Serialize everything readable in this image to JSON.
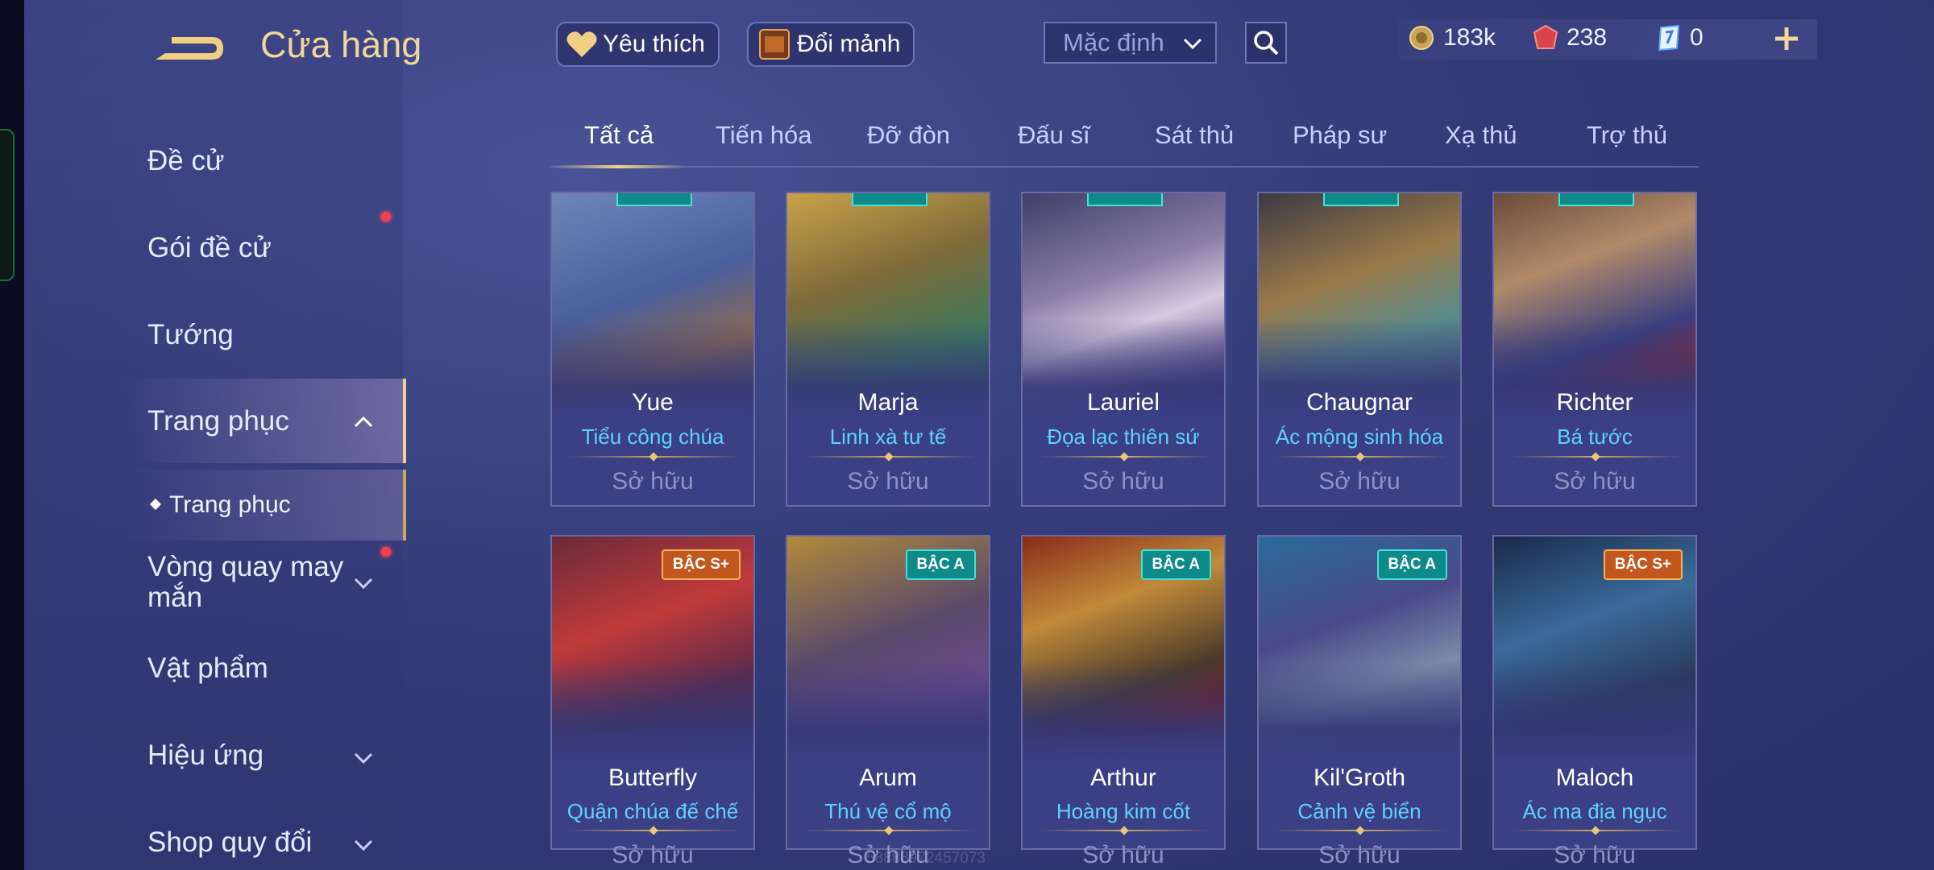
{
  "header": {
    "title": "Cửa hàng"
  },
  "sidebar": {
    "items": [
      {
        "label": "Đề cử"
      },
      {
        "label": "Gói đề cử"
      },
      {
        "label": "Tướng"
      },
      {
        "label": "Trang phục"
      },
      {
        "label": "Vòng quay may mắn"
      },
      {
        "label": "Vật phẩm"
      },
      {
        "label": "Hiệu ứng"
      },
      {
        "label": "Shop quy đổi"
      }
    ],
    "sub_item": "Trang phục"
  },
  "toolbar": {
    "favorite_label": "Yêu thích",
    "exchange_label": "Đổi mảnh",
    "sort_value": "Mặc định"
  },
  "currency": {
    "gold": "183k",
    "vouchers": "238",
    "tickets": "0"
  },
  "tabs": [
    "Tất cả",
    "Tiến hóa",
    "Đỡ đòn",
    "Đấu sĩ",
    "Sát thủ",
    "Pháp sư",
    "Xạ thủ",
    "Trợ thủ"
  ],
  "cards": [
    {
      "hero": "Yue",
      "skin": "Tiểu công chúa",
      "status": "Sở hữu",
      "badge": ""
    },
    {
      "hero": "Marja",
      "skin": "Linh xà tư tế",
      "status": "Sở hữu",
      "badge": ""
    },
    {
      "hero": "Lauriel",
      "skin": "Đọa lạc thiên sứ",
      "status": "Sở hữu",
      "badge": ""
    },
    {
      "hero": "Chaugnar",
      "skin": "Ác mộng sinh hóa",
      "status": "Sở hữu",
      "badge": ""
    },
    {
      "hero": "Richter",
      "skin": "Bá tước",
      "status": "Sở hữu",
      "badge": ""
    },
    {
      "hero": "Butterfly",
      "skin": "Quận chúa đế chế",
      "status": "Sở hữu",
      "badge": "BẬC S+"
    },
    {
      "hero": "Arum",
      "skin": "Thú vệ cổ mộ",
      "status": "Sở hữu",
      "badge": "BẬC A"
    },
    {
      "hero": "Arthur",
      "skin": "Hoàng kim cốt",
      "status": "Sở hữu",
      "badge": "BẬC A"
    },
    {
      "hero": "Kil'Groth",
      "skin": "Cảnh vệ biển",
      "status": "Sở hữu",
      "badge": "BẬC A"
    },
    {
      "hero": "Maloch",
      "skin": "Ác ma địa ngục",
      "status": "Sở hữu",
      "badge": "BẬC S+"
    }
  ],
  "watermark": "58888972457073",
  "colors": {
    "accent_gold": "#f1d79a",
    "skin_name": "#5fd2ff",
    "badge_s_plus": "#c1571d",
    "badge_a": "#0f8a8a",
    "red_dot": "#ff3a4a"
  }
}
